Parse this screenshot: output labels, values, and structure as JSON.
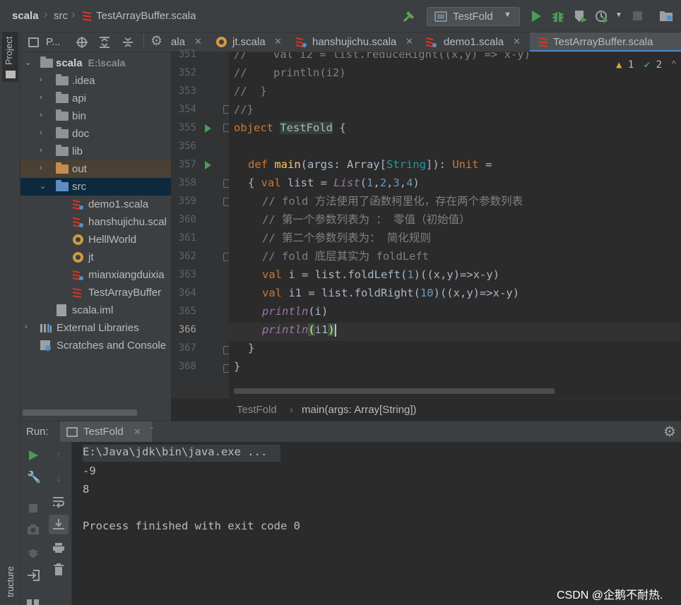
{
  "navbar": {
    "crumbs": [
      "scala",
      "src",
      "TestArrayBuffer.scala"
    ],
    "run_config": "TestFold"
  },
  "sidebar": {
    "project_tab": "Project",
    "structure_tab": "tructure",
    "toolbar_label": "P..."
  },
  "tree": {
    "root": {
      "label": "scala",
      "hint": "E:\\scala"
    },
    "folders": [
      ".idea",
      "api",
      "bin",
      "doc",
      "lib",
      "out",
      "src"
    ],
    "files": [
      "demo1.scala",
      "hanshujichu.scal",
      "HelllWorld",
      "jt",
      "mianxiangduixia",
      "TestArrayBuffer",
      "scala.iml"
    ],
    "external": "External Libraries",
    "scratches": "Scratches and Console"
  },
  "tabs": [
    {
      "label": "ala"
    },
    {
      "label": "jt.scala"
    },
    {
      "label": "hanshujichu.scala"
    },
    {
      "label": "demo1.scala"
    },
    {
      "label": "TestArrayBuffer.scala"
    }
  ],
  "inspection": {
    "warnings": "1",
    "weak": "2"
  },
  "line_numbers": [
    "351",
    "352",
    "353",
    "354",
    "355",
    "356",
    "357",
    "358",
    "359",
    "360",
    "361",
    "362",
    "363",
    "364",
    "365",
    "366",
    "367",
    "368"
  ],
  "code": {
    "l351": "//    val i2 = list.reduceRight((x,y) => x-y)",
    "l352": "//    println(i2)",
    "l353": "//  }",
    "l354": "//}",
    "l355a": "object ",
    "l355b": "TestFold",
    "l355c": " {",
    "l357a": "def ",
    "l357b": "main",
    "l357c": "(args: Array[",
    "l357d": "String",
    "l357e": "]): ",
    "l357f": "Unit",
    "l357g": " =",
    "l358a": "{ ",
    "l358b": "val ",
    "l358c": "list = ",
    "l358d": "List",
    "l358e": "(",
    "l358n1": "1",
    "l358n2": "2",
    "l358n3": "3",
    "l358n4": "4",
    "l358f": ")",
    "l359": "// fold 方法使用了函数柯里化，存在两个参数列表",
    "l360": "// 第一个参数列表为 ： 零值（初始值）",
    "l361": "// 第二个参数列表为： 简化规则",
    "l362": "// fold 底层其实为 foldLeft",
    "l363a": "val ",
    "l363b": "i = list.foldLeft(",
    "l363c": "1",
    "l363d": ")((",
    "l363e": "x",
    "l363f": ",",
    "l363g": "y",
    "l363h": ")=>",
    "l363i": "x",
    "l363j": "-",
    "l363k": "y",
    "l363l": ")",
    "l364a": "val ",
    "l364b": "i1 = list.foldRight(",
    "l364c": "10",
    "l364d": ")((",
    "l364e": "x",
    "l364f": ",",
    "l364g": "y",
    "l364h": ")=>",
    "l364i": "x",
    "l364j": "-",
    "l364k": "y",
    "l364l": ")",
    "l365a": "println",
    "l365b": "(i)",
    "l366a": "println",
    "l366b": "(",
    "l366c": "i1",
    "l366d": ")",
    "l367": "}",
    "l368": "}"
  },
  "breadcrumb": {
    "object": "TestFold",
    "method": "main(args: Array[String])"
  },
  "run": {
    "label": "Run:",
    "tab": "TestFold",
    "output": [
      "E:\\Java\\jdk\\bin\\java.exe ...",
      "-9",
      "8",
      "",
      "Process finished with exit code 0"
    ]
  },
  "watermark": "CSDN @企鹅不耐热."
}
